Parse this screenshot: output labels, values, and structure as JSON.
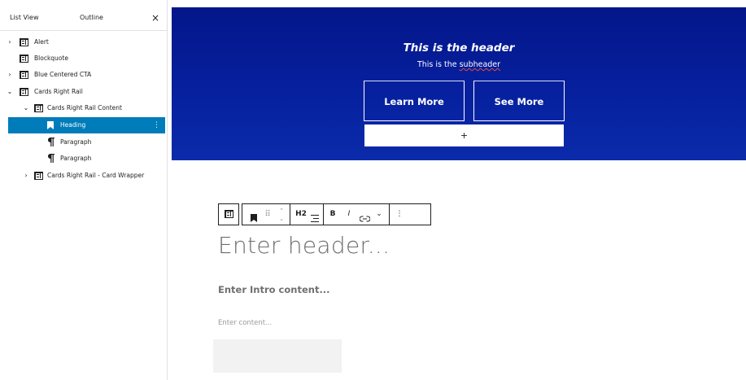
{
  "sidebar": {
    "tabs": {
      "list_view": "List View",
      "outline": "Outline",
      "close": "×"
    },
    "items": [
      {
        "label": "Alert",
        "expanded": false
      },
      {
        "label": "Blockquote"
      },
      {
        "label": "Blue Centered CTA",
        "expanded": false
      },
      {
        "label": "Cards Right Rail",
        "expanded": true
      },
      {
        "label": "Cards Right Rail Content",
        "expanded": true
      },
      {
        "label": "Heading",
        "selected": true
      },
      {
        "label": "Paragraph"
      },
      {
        "label": "Paragraph"
      },
      {
        "label": "Cards Right Rail - Card Wrapper",
        "expanded": false
      }
    ],
    "more_glyph": "⋮"
  },
  "hero": {
    "title": "This is the header",
    "subheader_prefix": "This is the ",
    "subheader_word": "subheader",
    "buttons": [
      "Learn More",
      "See More"
    ],
    "appender": "+"
  },
  "toolbar": {
    "heading_level": "H2",
    "bold": "B",
    "italic": "I",
    "drag": "⠿",
    "mover": "⌃",
    "link": "⇔",
    "more_rich": "⌄",
    "options": "⋮"
  },
  "content": {
    "header_placeholder": "Enter header...",
    "intro_placeholder": "Enter Intro content...",
    "content_placeholder": "Enter content..."
  },
  "colors": {
    "hero_bg": "#04168a",
    "selection": "#007cba",
    "text": "#1e1e1e"
  }
}
